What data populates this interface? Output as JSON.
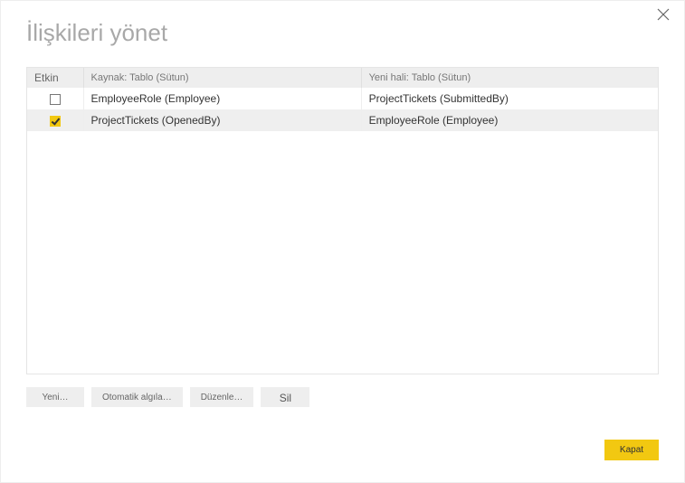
{
  "dialog": {
    "title": "İlişkileri yönet"
  },
  "table": {
    "headers": {
      "active": "Etkin",
      "from": "Kaynak: Tablo (Sütun)",
      "to": "Yeni hali: Tablo (Sütun)"
    },
    "rows": [
      {
        "active": false,
        "from": "EmployeeRole (Employee)",
        "to": "ProjectTickets (SubmittedBy)"
      },
      {
        "active": true,
        "from": "ProjectTickets (OpenedBy)",
        "to": "EmployeeRole (Employee)"
      }
    ]
  },
  "buttons": {
    "new": "Yeni…",
    "autodetect": "Otomatik algıla…",
    "edit": "Düzenle…",
    "delete": "Sil",
    "close": "Kapat"
  }
}
